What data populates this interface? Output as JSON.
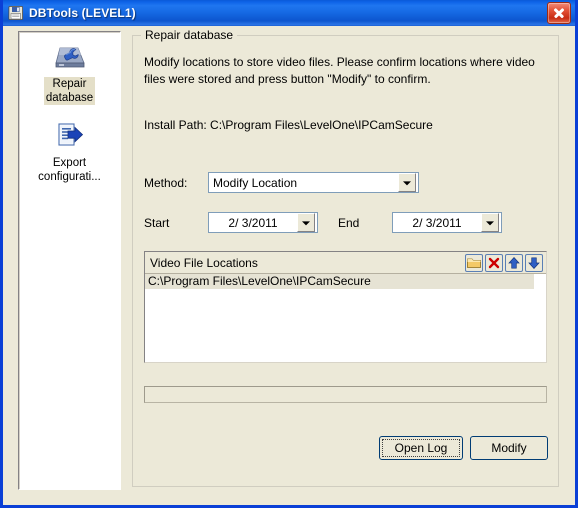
{
  "window": {
    "title": "DBTools (LEVEL1)",
    "title_icon": "floppy-disk-icon",
    "close_label": "Close",
    "titlebar_color": "#1568e2",
    "client_color": "#ece9d8"
  },
  "sidebar": {
    "items": [
      {
        "label_line1": "Repair",
        "label_line2": "database",
        "icon": "disk-wrench-icon",
        "selected": true
      },
      {
        "label_line1": "Export",
        "label_line2": "configurati...",
        "icon": "document-export-icon",
        "selected": false
      }
    ]
  },
  "groupbox": {
    "legend": "Repair database",
    "description": "Modify locations to store video files. Please confirm locations where video files were stored and press button \"Modify\" to confirm.",
    "install_path": "Install Path: C:\\Program Files\\LevelOne\\IPCamSecure"
  },
  "fields": {
    "method_label": "Method:",
    "method_value": "Modify Location",
    "start_label": "Start",
    "start_value": "2/  3/2011",
    "end_label": "End",
    "end_value": "2/  3/2011"
  },
  "locations": {
    "title": "Video File Locations",
    "tools": [
      {
        "name": "add-folder-icon",
        "title": "Add folder"
      },
      {
        "name": "delete-icon",
        "title": "Delete"
      },
      {
        "name": "move-up-icon",
        "title": "Move up"
      },
      {
        "name": "move-down-icon",
        "title": "Move down"
      }
    ],
    "rows": [
      {
        "path": "C:\\Program Files\\LevelOne\\IPCamSecure",
        "selected": true
      }
    ]
  },
  "progress": {
    "percent": 0
  },
  "buttons": {
    "open_log": "Open Log",
    "modify": "Modify"
  }
}
